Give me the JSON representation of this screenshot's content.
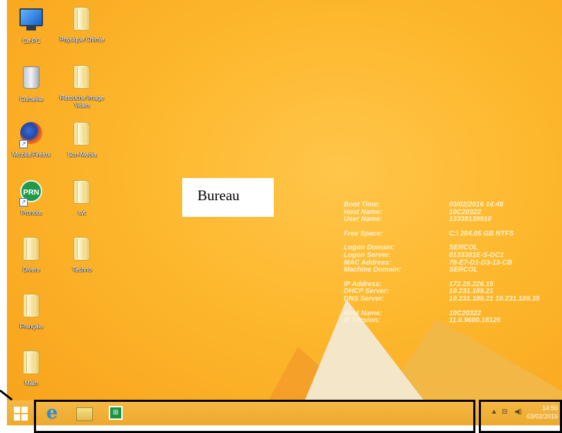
{
  "desktop": {
    "icons": [
      {
        "label": "Ce PC",
        "icon": "this-pc-icon"
      },
      {
        "label": "Physique Chimie",
        "icon": "folder-icon"
      },
      {
        "label": "Corbeille",
        "icon": "recycle-bin-icon"
      },
      {
        "label": "Retouche Image Video",
        "icon": "folder-icon"
      },
      {
        "label": "Mozilla Firefox",
        "icon": "firefox-icon"
      },
      {
        "label": "Son-Media",
        "icon": "folder-icon"
      },
      {
        "label": "Pronote",
        "icon": "pronote-icon",
        "badge": "PRN"
      },
      {
        "label": "svt",
        "icon": "folder-icon"
      },
      {
        "label": "Divers",
        "icon": "folder-icon"
      },
      {
        "label": "Techno",
        "icon": "folder-icon"
      },
      {
        "label": "Français",
        "icon": "folder-icon"
      },
      {
        "label": "Math",
        "icon": "folder-icon"
      }
    ]
  },
  "annotation": {
    "bureau_label": "Bureau"
  },
  "bginfo": {
    "boot_time_key": "Boot Time:",
    "boot_time": "03/02/2016 14:48",
    "host_name_key": "Host Name:",
    "host_name": "10C20322",
    "user_name_key": "User Name:",
    "user_name": "13338139910",
    "free_space_key": "Free Space:",
    "free_space": "C:\\ 204.05 GB NTFS",
    "logon_domain_key": "Logon Domain:",
    "logon_domain": "SERCOL",
    "logon_server_key": "Logon Server:",
    "logon_server": "0133381E-S-DC1",
    "mac_key": "MAC Address:",
    "mac": "78-E7-D1-D3-13-CB",
    "machine_domain_key": "Machine Domain:",
    "machine_domain": "SERCOL",
    "ip_key": "IP Address:",
    "ip": "172.28.226.15",
    "dhcp_key": "DHCP Server:",
    "dhcp": "10.231.189.21",
    "dns_key": "DNS Server:",
    "dns": "10.231.189.21 10.231.189.35",
    "host_name2_key": "Host Name:",
    "host_name2": "10C20322",
    "ie_key": "IE Version:",
    "ie": "11.0.9600.18126"
  },
  "taskbar": {
    "start_icon": "windows-logo-icon",
    "pinned": [
      "internet-explorer-icon",
      "file-explorer-icon",
      "store-icon"
    ],
    "tray": {
      "chevron": "▲",
      "time": "14:50",
      "date": "03/02/2016"
    }
  }
}
